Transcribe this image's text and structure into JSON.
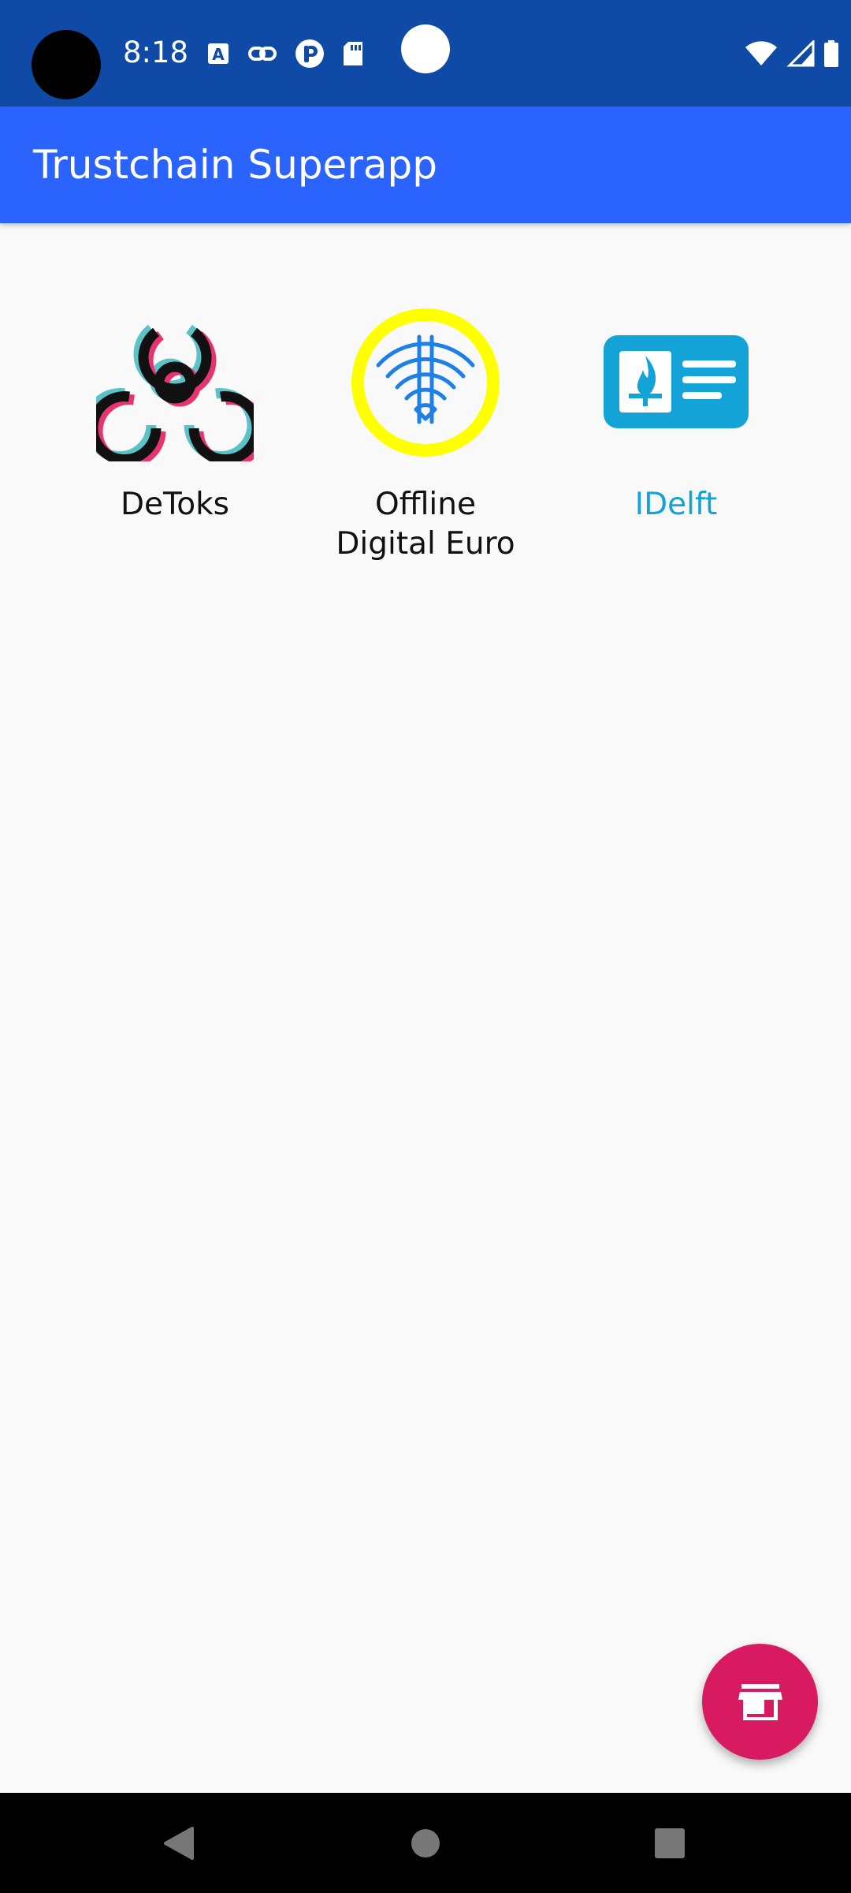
{
  "status_bar": {
    "time": "8:18",
    "icons_left": [
      "text-a-icon",
      "link-icon",
      "pinterest-icon",
      "sd-card-icon"
    ],
    "icons_right": [
      "wifi-icon",
      "signal-icon",
      "battery-icon"
    ]
  },
  "app_bar": {
    "title": "Trustchain Superapp"
  },
  "apps": [
    {
      "label": "DeToks",
      "icon": "biohazard-icon"
    },
    {
      "label_line1": "Offline",
      "label_line2": "Digital Euro",
      "icon": "wifi-ring-icon"
    },
    {
      "label": "IDelft",
      "icon": "id-card-flame-icon"
    }
  ],
  "fab": {
    "icon": "store-icon"
  },
  "nav_bar": {
    "buttons": [
      "back-icon",
      "home-icon",
      "recents-icon"
    ]
  },
  "colors": {
    "status_bar": "#0f4ba6",
    "app_bar": "#2b63ff",
    "background": "#f9f9f9",
    "fab": "#d81b60",
    "idelft_accent": "#14a3d6",
    "euro_ring": "#ffff00",
    "euro_wifi": "#1e7fe6"
  }
}
